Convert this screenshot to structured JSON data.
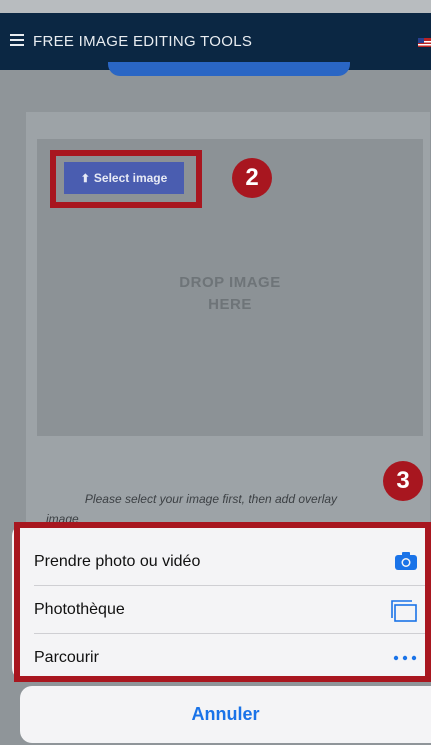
{
  "navbar": {
    "title": "FREE IMAGE EDITING TOOLS",
    "menu_icon": "hamburger-icon",
    "flag_icon": "us-flag-icon"
  },
  "uploader": {
    "select_label": "Select image",
    "upload_icon": "upload-icon",
    "drop_text_line1": "DROP IMAGE",
    "drop_text_line2": "HERE",
    "hint_line1": "Please select your image first, then add overlay",
    "hint_line2": "image"
  },
  "badges": {
    "step2": "2",
    "step3": "3"
  },
  "action_sheet": {
    "items": [
      {
        "label": "Prendre photo ou vidéo",
        "icon": "camera-icon"
      },
      {
        "label": "Photothèque",
        "icon": "photo-library-icon"
      },
      {
        "label": "Parcourir",
        "icon": "more-icon"
      }
    ],
    "cancel_label": "Annuler"
  },
  "colors": {
    "highlight": "#a8161f",
    "navbar": "#0b2743",
    "ios_blue": "#1a73e8",
    "select_button": "#4a5db0"
  }
}
